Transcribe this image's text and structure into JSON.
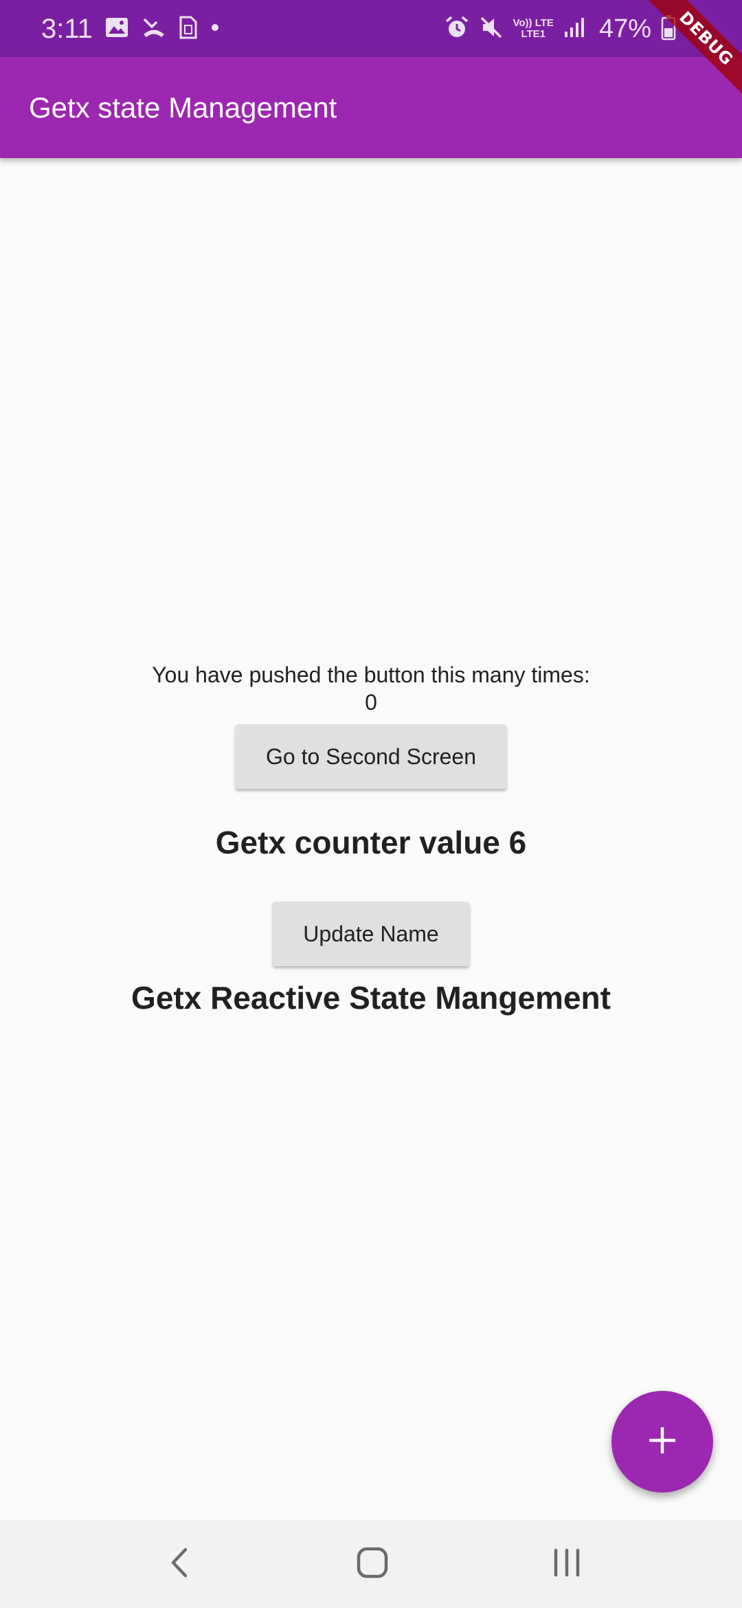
{
  "status_bar": {
    "time": "3:11",
    "battery": "47%",
    "network_top": "Vo)) LTE",
    "network_bottom": "LTE1",
    "left_icons": [
      "image-icon",
      "missed-call-icon",
      "sim-card-icon",
      "dot-icon"
    ],
    "right_icons": [
      "alarm-icon",
      "mute-icon",
      "signal-icon",
      "battery-icon"
    ]
  },
  "debug_banner": {
    "label": "DEBUG"
  },
  "app_bar": {
    "title": "Getx state Management"
  },
  "main": {
    "pushed_label": "You have pushed the button this many times:",
    "count": "0",
    "second_screen_button": "Go to Second Screen",
    "getx_counter_text": "Getx counter value 6",
    "update_name_button": "Update Name",
    "reactive_text": "Getx Reactive State Mangement"
  },
  "fab": {
    "icon": "plus-icon"
  },
  "nav_bar": {
    "icons": [
      "back-icon",
      "home-icon",
      "recents-icon"
    ]
  },
  "colors": {
    "primary": "#9c27b0",
    "primary_dark": "#7b1fa2",
    "button_grey": "#e0e0e0",
    "background": "#fafafa"
  }
}
